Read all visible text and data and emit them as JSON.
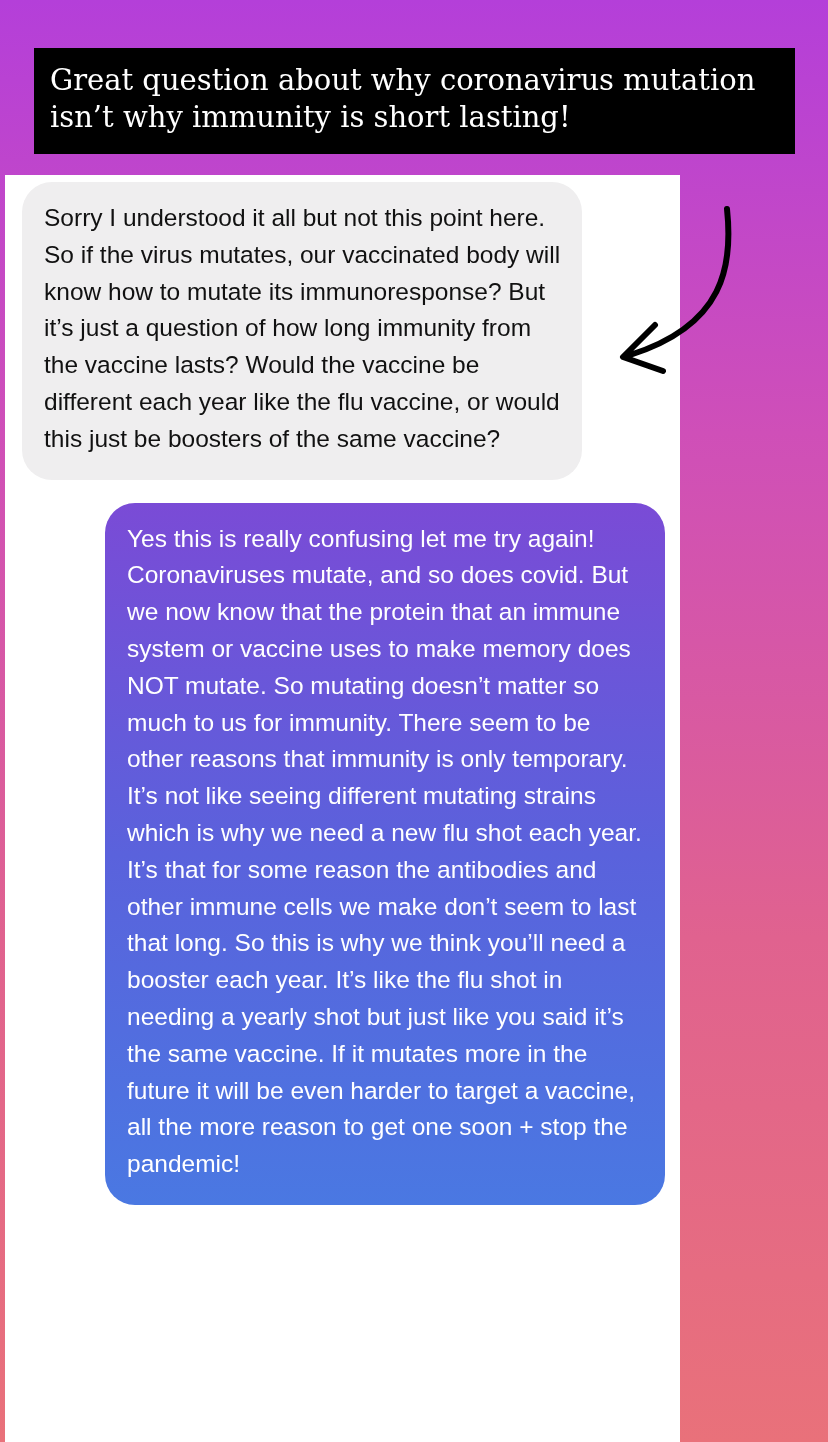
{
  "caption": "Great question about why coronavirus mutation isn’t why immunity is short lasting!",
  "messages": [
    {
      "kind": "received",
      "text": "Sorry I understood it all but not this point here. So if the virus mutates, our vaccinated body will know how to mutate  its immunoresponse? But it’s just a question of how long immunity from the vaccine lasts? Would the vaccine be different each year like the flu vaccine, or would this just be boosters of the same vaccine?"
    },
    {
      "kind": "sent",
      "text": "Yes this is really confusing let me try again! Coronaviruses mutate, and so does covid. But we now know that the protein that an immune system or vaccine uses to make memory does NOT mutate. So mutating doesn’t matter so much to us for immunity. There seem to be other reasons that immunity is only temporary. It’s not like seeing different mutating strains which is why we need a new flu shot each year. It’s that for some reason the antibodies and other immune cells we make don’t seem to last that long. So this is why we think you’ll need a booster each year. It’s like the flu shot in needing a yearly shot but just like you said it’s the same vaccine. If it mutates more in the future it will be even harder to target a vaccine, all the more reason to get one soon + stop the pandemic!"
    }
  ]
}
